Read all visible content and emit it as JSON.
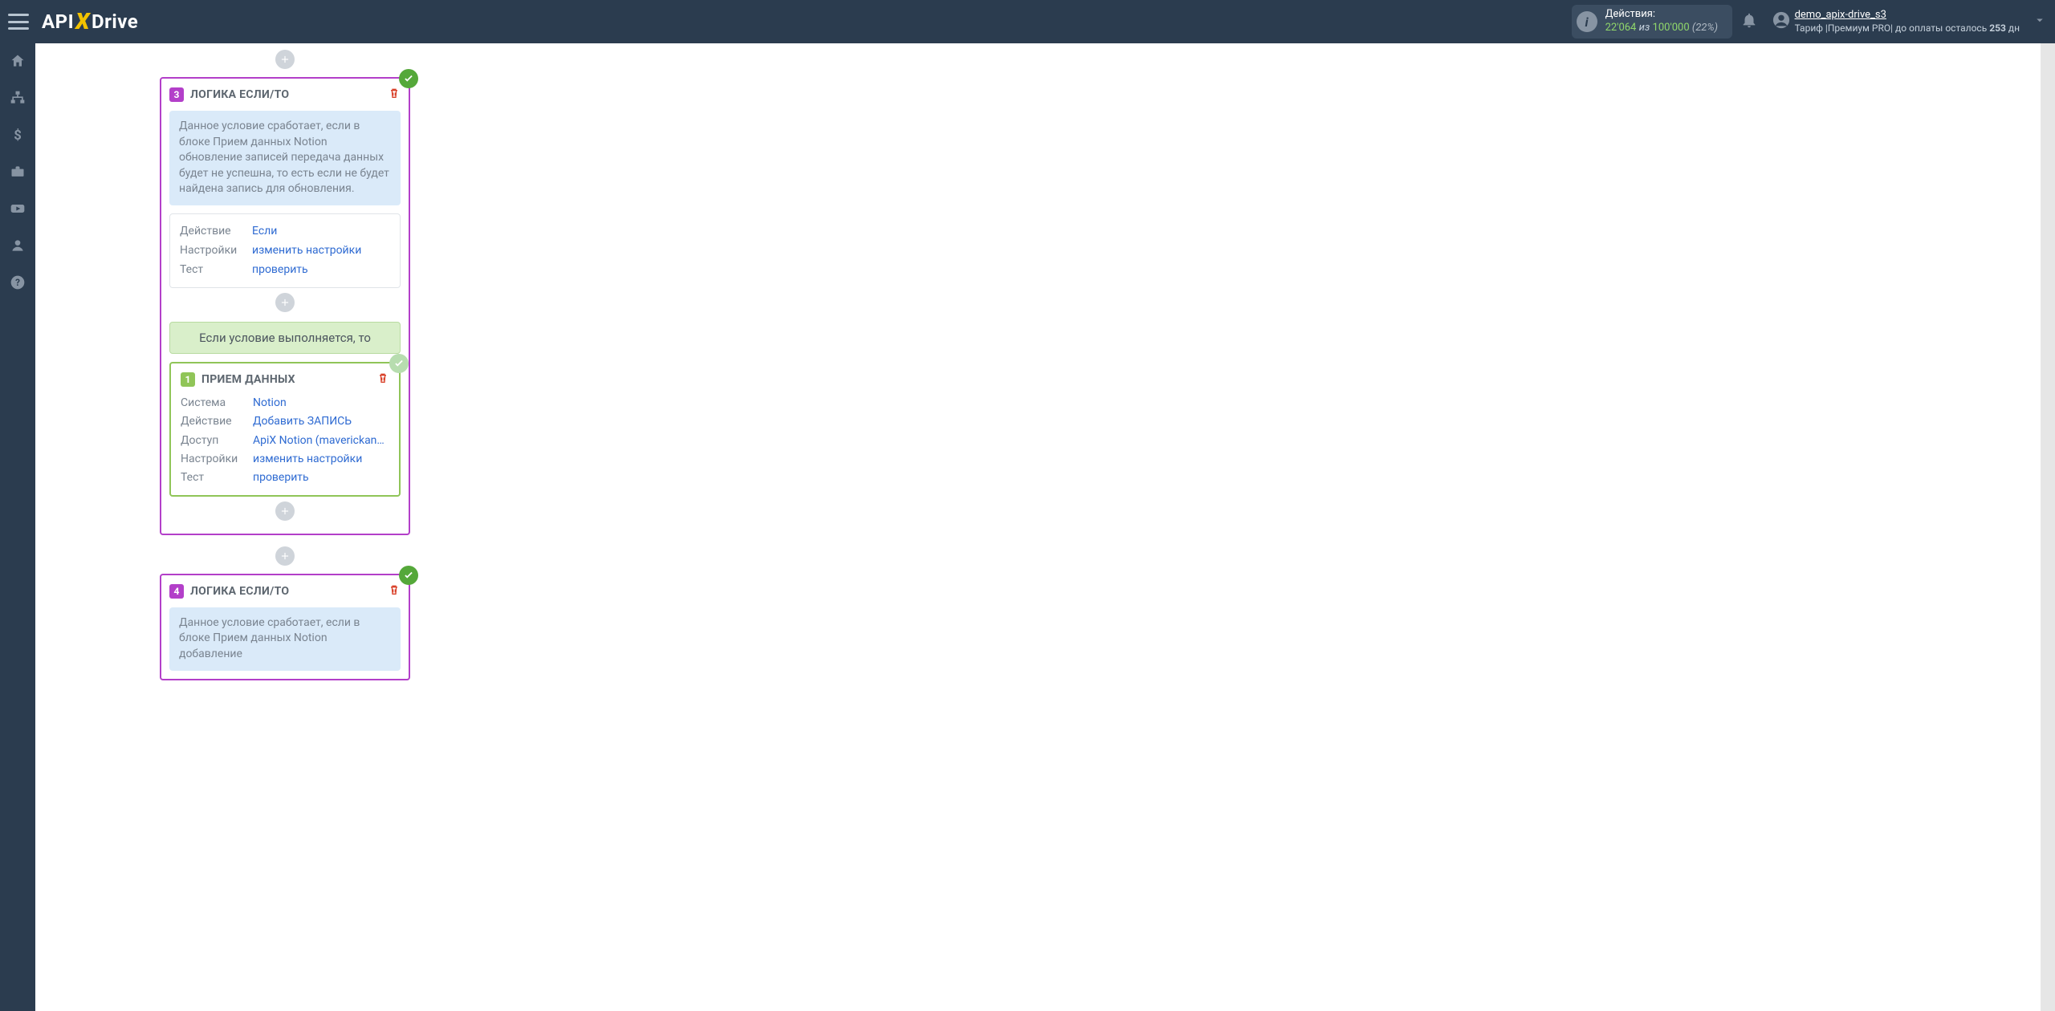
{
  "header": {
    "logo_pre": "API",
    "logo_x": "X",
    "logo_post": "Drive",
    "actions_label": "Действия:",
    "actions_count": "22'064",
    "actions_of": "из",
    "actions_limit": "100'000",
    "actions_pct": "(22%)",
    "username": "demo_apix-drive_s3",
    "tariff_prefix": "Тариф |",
    "tariff_name": "Премиум PRO",
    "tariff_mid": "| до оплаты осталось ",
    "tariff_days": "253",
    "tariff_suffix": " дн"
  },
  "card3": {
    "step": "3",
    "title": "ЛОГИКА ЕСЛИ/ТО",
    "note": "Данное условие сработает, если в блоке Прием данных Notion обновление записей передача данных будет не успешна, то есть если не будет найдена запись для обновления.",
    "labels": {
      "action": "Действие",
      "settings": "Настройки",
      "test": "Тест"
    },
    "values": {
      "action": "Если",
      "settings": "изменить настройки",
      "test": "проверить"
    },
    "cond_banner": "Если условие выполняется, то"
  },
  "card3_inner": {
    "step": "1",
    "title": "ПРИЕМ ДАННЫХ",
    "labels": {
      "system": "Система",
      "action": "Действие",
      "access": "Доступ",
      "settings": "Настройки",
      "test": "Тест"
    },
    "values": {
      "system": "Notion",
      "action": "Добавить ЗАПИСЬ",
      "access": "ApiX Notion (maverickandrew)",
      "settings": "изменить настройки",
      "test": "проверить"
    }
  },
  "card4": {
    "step": "4",
    "title": "ЛОГИКА ЕСЛИ/ТО",
    "note": "Данное условие сработает, если в блоке Прием данных Notion добавление"
  }
}
